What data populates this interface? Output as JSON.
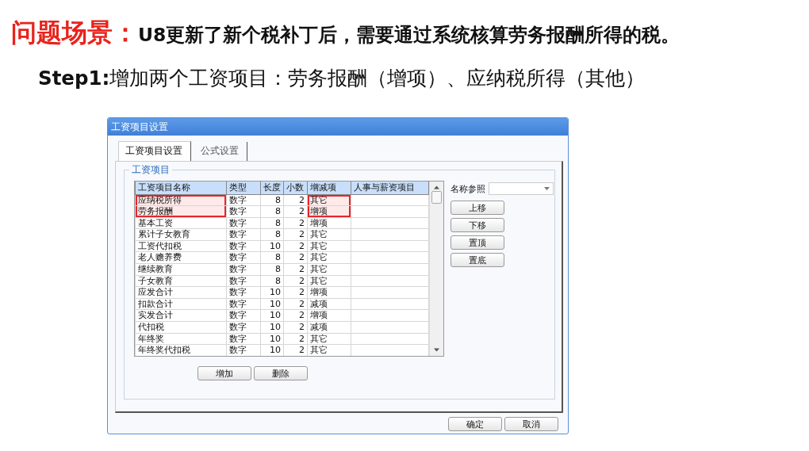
{
  "slide": {
    "title_label": "问题场景：",
    "title": "U8更新了新个税补丁后，需要通过系统核算劳务报酬所得的税。",
    "step": "**Step1:**增加两个工资项目：劳务报酬（增项）、应纳税所得（其他）"
  },
  "dialog": {
    "title": "工资项目设置",
    "tabs": [
      {
        "label": "工资项目设置",
        "selected": true
      },
      {
        "label": "公式设置",
        "selected": false
      }
    ],
    "group_title": "工资项目",
    "table": {
      "columns": [
        {
          "label": "工资项目名称",
          "kind": "text"
        },
        {
          "label": "类型",
          "kind": "text"
        },
        {
          "label": "长度",
          "kind": "number"
        },
        {
          "label": "小数",
          "kind": "number"
        },
        {
          "label": "增减项",
          "kind": "text"
        },
        {
          "label": "人事与薪资项目",
          "kind": "text"
        }
      ],
      "rows": [
        {
          "cells": [
            "应纳税所得",
            "数字",
            "8",
            "2",
            "其它",
            ""
          ],
          "name_highlighted": true,
          "change_highlighted": true
        },
        {
          "cells": [
            "劳务报酬",
            "数字",
            "8",
            "2",
            "增项",
            ""
          ],
          "name_highlighted": true,
          "change_highlighted": true
        },
        {
          "cells": [
            "基本工资",
            "数字",
            "8",
            "2",
            "增项",
            ""
          ],
          "name_highlighted": false,
          "change_highlighted": false
        },
        {
          "cells": [
            "累计子女教育",
            "数字",
            "8",
            "2",
            "其它",
            ""
          ],
          "name_highlighted": false,
          "change_highlighted": false
        },
        {
          "cells": [
            "工资代扣税",
            "数字",
            "10",
            "2",
            "其它",
            ""
          ],
          "name_highlighted": false,
          "change_highlighted": false
        },
        {
          "cells": [
            "老人赡养费",
            "数字",
            "8",
            "2",
            "其它",
            ""
          ],
          "name_highlighted": false,
          "change_highlighted": false
        },
        {
          "cells": [
            "继续教育",
            "数字",
            "8",
            "2",
            "其它",
            ""
          ],
          "name_highlighted": false,
          "change_highlighted": false
        },
        {
          "cells": [
            "子女教育",
            "数字",
            "8",
            "2",
            "其它",
            ""
          ],
          "name_highlighted": false,
          "change_highlighted": false
        },
        {
          "cells": [
            "应发合计",
            "数字",
            "10",
            "2",
            "增项",
            ""
          ],
          "name_highlighted": false,
          "change_highlighted": false
        },
        {
          "cells": [
            "扣款合计",
            "数字",
            "10",
            "2",
            "减项",
            ""
          ],
          "name_highlighted": false,
          "change_highlighted": false
        },
        {
          "cells": [
            "实发合计",
            "数字",
            "10",
            "2",
            "增项",
            ""
          ],
          "name_highlighted": false,
          "change_highlighted": false
        },
        {
          "cells": [
            "代扣税",
            "数字",
            "10",
            "2",
            "减项",
            ""
          ],
          "name_highlighted": false,
          "change_highlighted": false
        },
        {
          "cells": [
            "年终奖",
            "数字",
            "10",
            "2",
            "其它",
            ""
          ],
          "name_highlighted": false,
          "change_highlighted": false
        },
        {
          "cells": [
            "年终奖代扣税",
            "数字",
            "10",
            "2",
            "其它",
            ""
          ],
          "name_highlighted": false,
          "change_highlighted": false
        }
      ]
    },
    "name_ref": {
      "label": "名称参照"
    },
    "side_buttons": [
      "上移",
      "下移",
      "置顶",
      "置底"
    ],
    "table_buttons": [
      "增加",
      "删除"
    ],
    "footer_buttons": [
      "确定",
      "取消"
    ]
  }
}
